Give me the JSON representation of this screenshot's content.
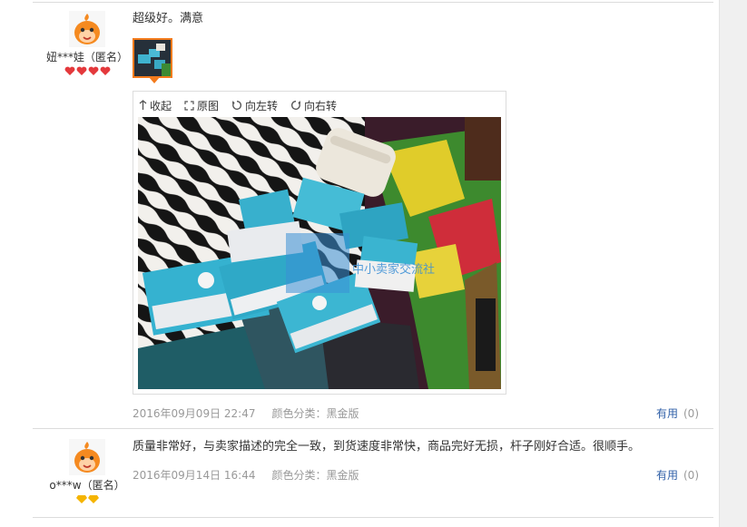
{
  "reviews": [
    {
      "user": "妞***娃（匿名）",
      "rank_icon": "red-heart-icon",
      "rank_count": 4,
      "text": "超级好。满意",
      "date": "2016年09月09日 22:47",
      "spec": "颜色分类：黑金版",
      "useful_label": "有用",
      "useful_count": "(0)",
      "viewer": {
        "collapse": "收起",
        "original": "原图",
        "rotate_left": "向左转",
        "rotate_right": "向右转"
      },
      "watermark": "中小卖家交流社"
    },
    {
      "user": "o***w（匿名）",
      "rank_icon": "yellow-diamond-icon",
      "rank_count": 2,
      "text": "质量非常好，与卖家描述的完全一致，到货速度非常快，商品完好无损，杆子刚好合适。很顺手。",
      "date": "2016年09月14日 16:44",
      "spec": "颜色分类：黑金版",
      "useful_label": "有用",
      "useful_count": "(0)"
    }
  ],
  "colors": {
    "accent_orange": "#f37b1d",
    "link_blue": "#3060a8",
    "meta_gray": "#999999",
    "heart_red": "#e4393c",
    "diamond_yellow": "#f5b400"
  }
}
